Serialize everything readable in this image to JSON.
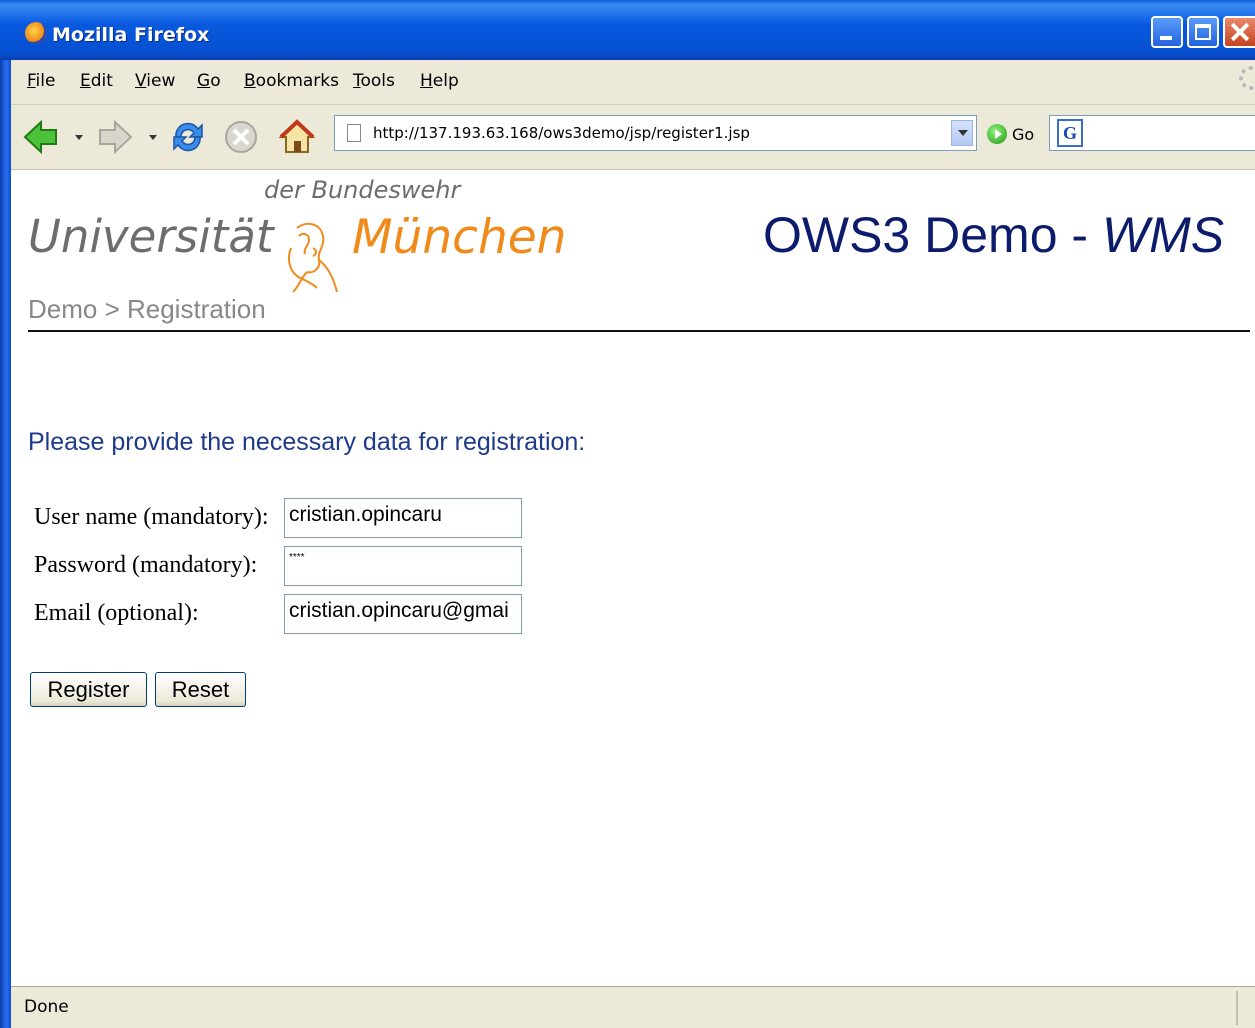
{
  "window": {
    "title": "Mozilla Firefox"
  },
  "menubar": {
    "items": [
      {
        "label": "File",
        "u": "F",
        "rest": "ile"
      },
      {
        "label": "Edit",
        "u": "E",
        "rest": "dit"
      },
      {
        "label": "View",
        "u": "V",
        "rest": "iew"
      },
      {
        "label": "Go",
        "u": "G",
        "rest": "o"
      },
      {
        "label": "Bookmarks",
        "u": "B",
        "rest": "ookmarks"
      },
      {
        "label": "Tools",
        "u": "T",
        "rest": "ools"
      },
      {
        "label": "Help",
        "u": "H",
        "rest": "elp"
      }
    ]
  },
  "navbar": {
    "url": "http://137.193.63.168/ows3demo/jsp/register1.jsp",
    "go_label": "Go",
    "icons": [
      "back-icon",
      "forward-icon",
      "reload-icon",
      "stop-icon",
      "home-icon"
    ]
  },
  "page": {
    "logo": {
      "sub": "der Bundeswehr",
      "main": "Universität",
      "city": "München"
    },
    "title_prefix": "OWS3 Demo - ",
    "title_em": "WMS",
    "breadcrumb": "Demo > Registration",
    "intro": "Please provide the necessary data for registration:",
    "form": {
      "username_label": "User name (mandatory):",
      "username_value": "cristian.opincaru",
      "password_label": "Password (mandatory):",
      "password_value": "****",
      "email_label": "Email (optional):",
      "email_value": "cristian.opincaru@gmai"
    },
    "buttons": {
      "register": "Register",
      "reset": "Reset"
    }
  },
  "statusbar": {
    "text": "Done"
  },
  "colors": {
    "title_blue": "#0c1b6b",
    "logo_orange": "#f08a1a",
    "logo_gray": "#6d6d6d",
    "intro_blue": "#1e3a8a"
  }
}
